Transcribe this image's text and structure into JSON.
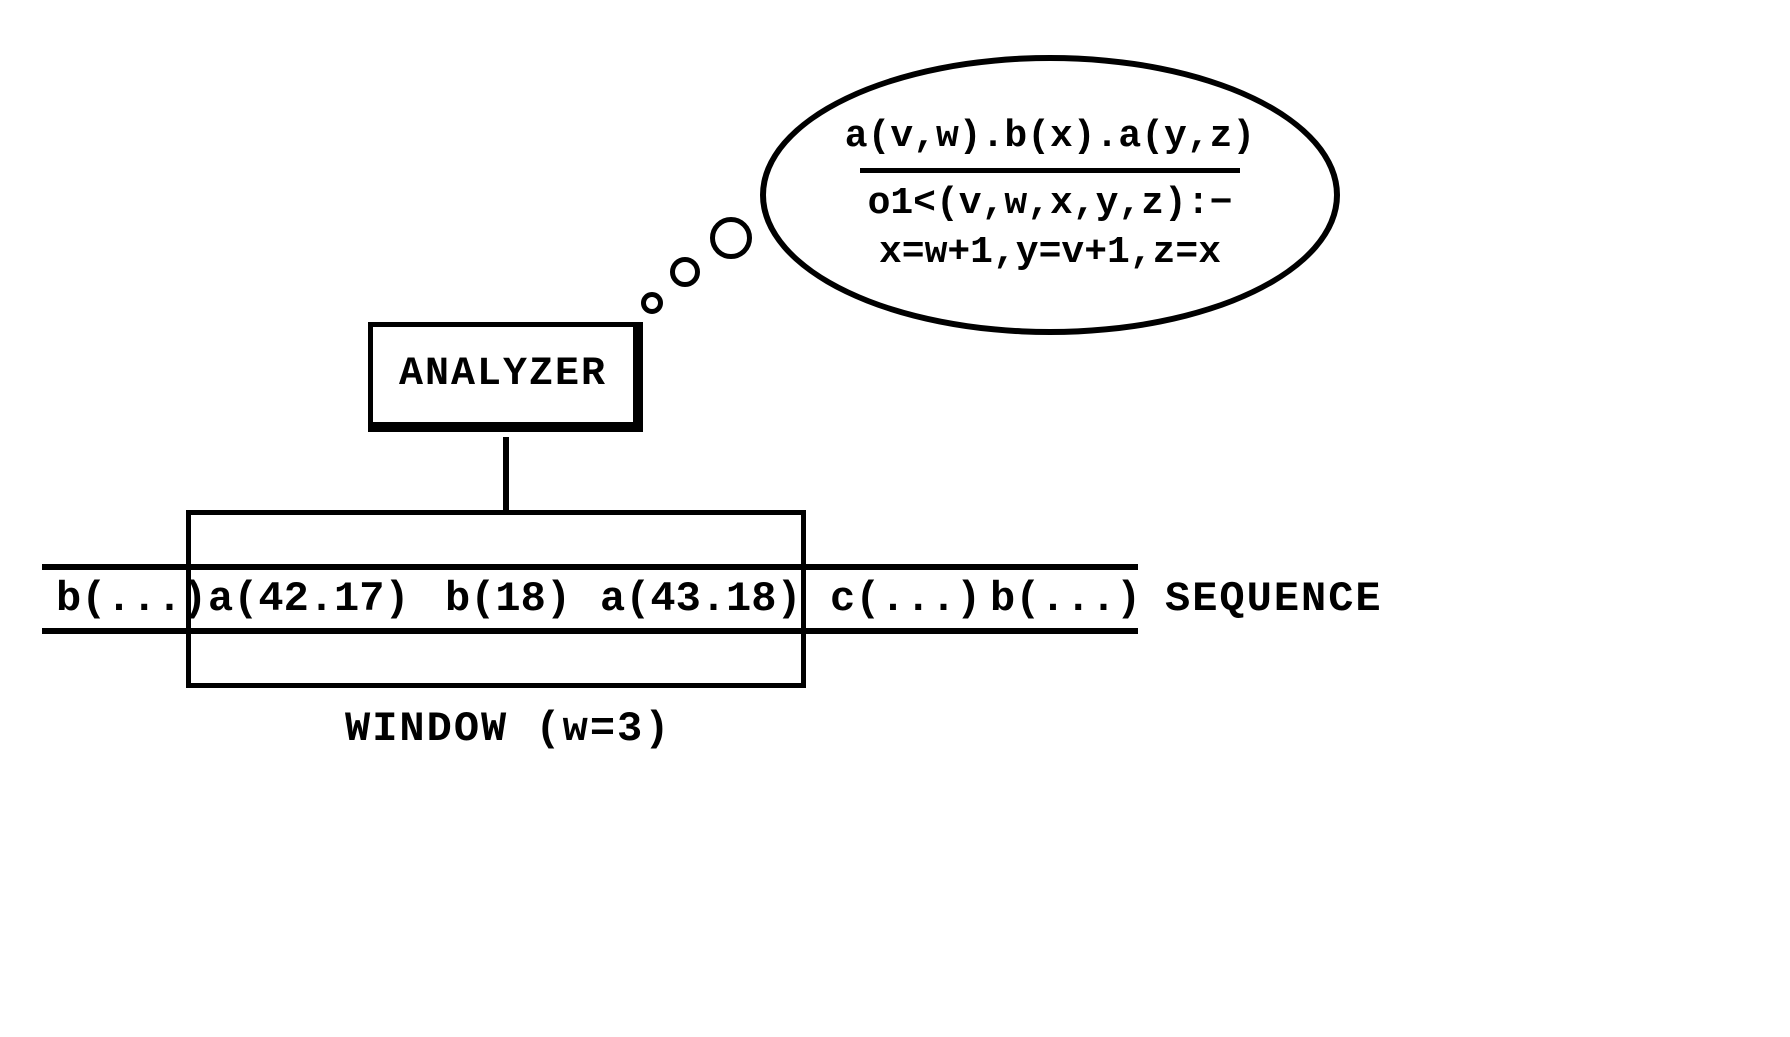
{
  "analyzer": {
    "label": "ANALYZER"
  },
  "thought": {
    "numerator": "a(v,w).b(x).a(y,z)",
    "denom1": "o1<(v,w,x,y,z):−",
    "denom2": "x=w+1,y=v+1,z=x"
  },
  "sequence": {
    "before": "b(...)",
    "in1": "a(42.17)",
    "in2": "b(18)",
    "in3": "a(43.18)",
    "after1": "c(...)",
    "after2": "b(...)",
    "label": "SEQUENCE"
  },
  "window": {
    "label": "WINDOW (w=3)"
  }
}
